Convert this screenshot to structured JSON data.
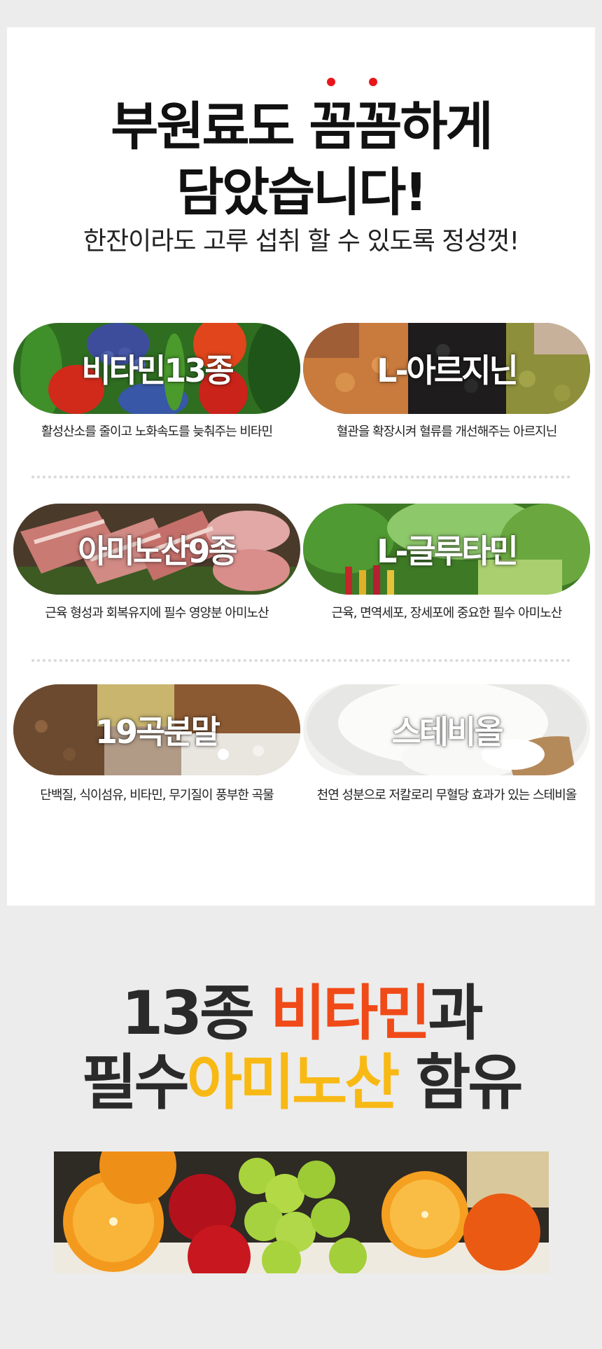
{
  "headline": {
    "line1": "부원료도 꼼꼼하게",
    "line2": "담았습니다!",
    "subtitle": "한잔이라도 고루 섭취 할 수 있도록 정성껏!"
  },
  "ingredients": [
    {
      "label": "비타민13종",
      "caption": "활성산소를 줄이고 노화속도를 늦춰주는 비타민",
      "image": "vegetables-photo"
    },
    {
      "label": "L-아르지닌",
      "caption": "혈관을 확장시켜 혈류를 개선해주는 아르지닌",
      "image": "beans-photo"
    },
    {
      "label": "아미노산9종",
      "caption": "근육 형성과 회복유지에 필수 영양분 아미노산",
      "image": "meat-photo"
    },
    {
      "label": "L-글루타민",
      "caption": "근육, 면역세포, 장세포에 중요한 필수 아미노산",
      "image": "greens-photo"
    },
    {
      "label": "19곡분말",
      "caption": "단백질, 식이섬유, 비타민, 무기질이 풍부한 곡물",
      "image": "grains-photo"
    },
    {
      "label": "스테비올",
      "caption": "천연 성분으로 저칼로리 무혈당 효과가 있는 스테비올",
      "image": "stevia-powder-photo"
    }
  ],
  "bottom": {
    "line1_part1": "13종 ",
    "line1_part2": "비타민",
    "line1_part3": "과",
    "line2_part1": "필수",
    "line2_part2": "아미노산",
    "line2_part3": " 함유",
    "image": "fruits-photo"
  },
  "colors": {
    "accent_red": "#e8161b",
    "accent_orange": "#f04a18",
    "accent_yellow": "#f8b915",
    "card_bg": "#ffffff",
    "page_bg": "#ececec"
  }
}
